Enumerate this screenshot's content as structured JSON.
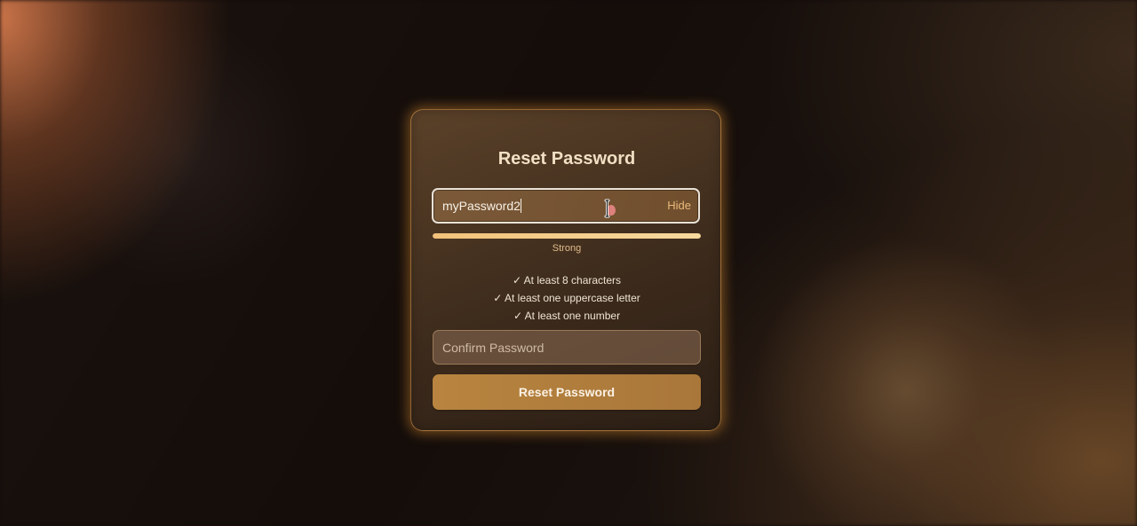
{
  "form": {
    "title": "Reset Password",
    "password": {
      "value": "myPassword2",
      "toggle_label": "Hide"
    },
    "strength": {
      "label": "Strong",
      "level": 1.0,
      "color": "#f2c27a"
    },
    "requirements": [
      "✓ At least 8 characters",
      "✓ At least one uppercase letter",
      "✓ At least one number"
    ],
    "confirm": {
      "placeholder": "Confirm Password",
      "value": ""
    },
    "submit_label": "Reset Password"
  },
  "colors": {
    "accent": "#b8843f",
    "glow": "#eb9632"
  },
  "icons": {
    "cursor": "text-cursor-icon"
  }
}
